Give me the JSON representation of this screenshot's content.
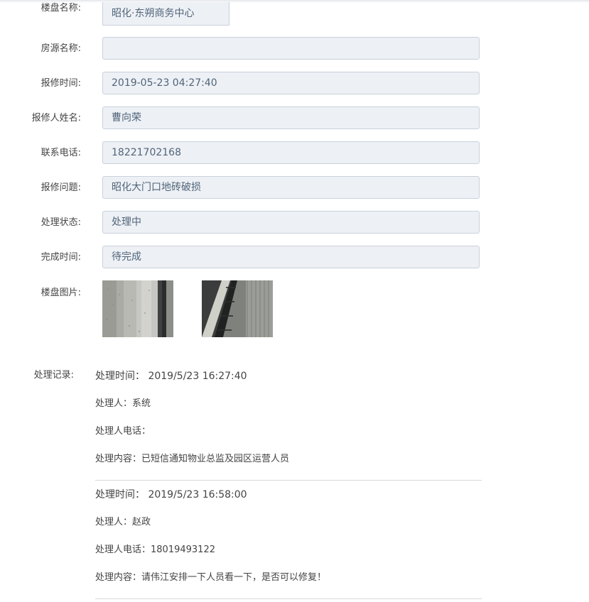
{
  "form": {
    "fields": [
      {
        "label": "楼盘名称:",
        "value": "昭化·东朔商务中心"
      },
      {
        "label": "房源名称:",
        "value": ""
      },
      {
        "label": "报修时间:",
        "value": "2019-05-23 04:27:40"
      },
      {
        "label": "报修人姓名:",
        "value": "曹向荣"
      },
      {
        "label": "联系电话:",
        "value": "18221702168"
      },
      {
        "label": "报修问题:",
        "value": "昭化大门口地砖破损"
      },
      {
        "label": "处理状态:",
        "value": "处理中"
      },
      {
        "label": "完成时间:",
        "value": "待完成"
      }
    ],
    "images_label": "楼盘图片:"
  },
  "records": {
    "label": "处理记录:",
    "time_prefix": "处理时间：",
    "person_prefix": "处理人：",
    "phone_prefix": "处理人电话：",
    "content_prefix": "处理内容：",
    "items": [
      {
        "time": "2019/5/23 16:27:40",
        "person": "系统",
        "phone": "",
        "content": "已短信通知物业总监及园区运营人员"
      },
      {
        "time": "2019/5/23 16:58:00",
        "person": "赵政",
        "phone": "18019493122",
        "content": "请伟江安排一下人员看一下，是否可以修复！"
      }
    ]
  }
}
